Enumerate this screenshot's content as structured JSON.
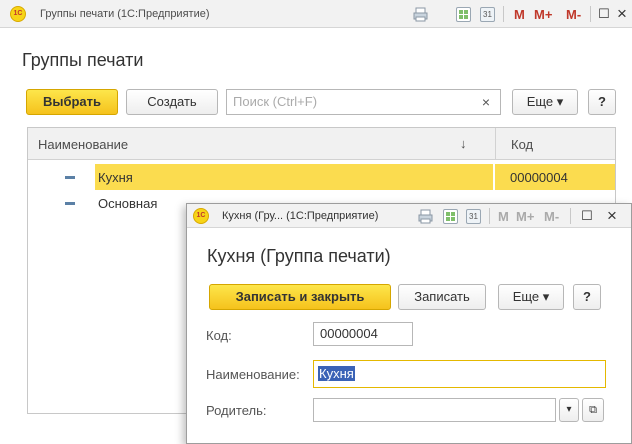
{
  "main": {
    "window_title": "Группы печати  (1С:Предприятие)",
    "logo_text": "1С",
    "titlebar_buttons": {
      "m": "M",
      "m_plus": "M+",
      "m_minus": "M-",
      "restore": "☐",
      "close": "×"
    },
    "page_title": "Группы печати",
    "toolbar": {
      "select_label": "Выбрать",
      "create_label": "Создать",
      "search_placeholder": "Поиск (Ctrl+F)",
      "clear_label": "×",
      "more_label": "Еще ▾",
      "help_label": "?"
    },
    "table": {
      "columns": [
        "Наименование",
        "Код"
      ],
      "sort_indicator": "↓",
      "rows": [
        {
          "name": "Кухня",
          "code": "00000004",
          "selected": true
        },
        {
          "name": "Основная",
          "code": "",
          "selected": false
        }
      ]
    }
  },
  "child": {
    "window_title": "Кухня (Гру...  (1С:Предприятие)",
    "logo_text": "1С",
    "titlebar_buttons": {
      "m": "M",
      "m_plus": "M+",
      "m_minus": "M-",
      "restore": "☐",
      "close": "×"
    },
    "page_title": "Кухня (Группа печати)",
    "toolbar": {
      "save_close_label": "Записать и закрыть",
      "save_label": "Записать",
      "more_label": "Еще ▾",
      "help_label": "?"
    },
    "fields": {
      "code_label": "Код:",
      "code_value": "00000004",
      "name_label": "Наименование:",
      "name_value": "Кухня",
      "parent_label": "Родитель:",
      "parent_value": "",
      "dropdown_label": "▾",
      "open_label": "⧉"
    }
  },
  "colors": {
    "accent_yellow": "#fbdc4f",
    "selection_blue": "#3a62b6",
    "title_red": "#c0392b"
  }
}
